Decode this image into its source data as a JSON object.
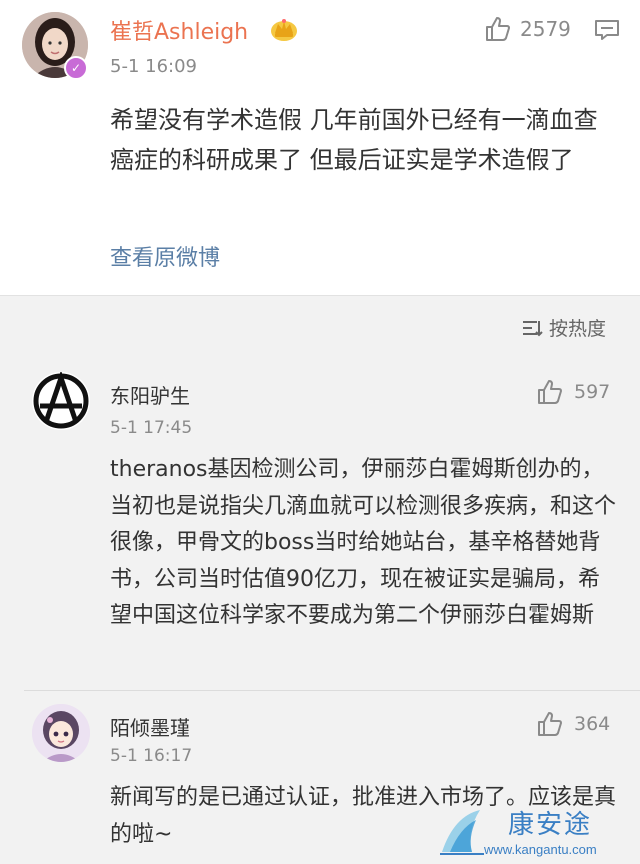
{
  "main_comment": {
    "username": "崔哲Ashleigh",
    "badge": "✓",
    "time": "5-1 16:09",
    "likes": "2579",
    "content": "希望没有学术造假 几年前国外已经有一滴血查癌症的科研成果了 但最后证实是学术造假了",
    "view_original": "查看原微博"
  },
  "sort": {
    "label": "按热度",
    "icon": "sort-icon"
  },
  "replies": [
    {
      "username": "东阳驴生",
      "time": "5-1 17:45",
      "likes": "597",
      "content": "theranos基因检测公司，伊丽莎白霍姆斯创办的，当初也是说指尖几滴血就可以检测很多疾病，和这个很像，甲骨文的boss当时给她站台，基辛格替她背书，公司当时估值90亿刀，现在被证实是骗局，希望中国这位科学家不要成为第二个伊丽莎白霍姆斯",
      "avatar": "anarchy-symbol-avatar"
    },
    {
      "username": "陌倾墨瑾",
      "time": "5-1 16:17",
      "likes": "364",
      "content": "新闻写的是已通过认证，批准进入市场了。应该是真的啦~",
      "avatar": "cartoon-girl-avatar"
    }
  ],
  "watermark": {
    "text": "康安途",
    "url": "www.kangantu.com"
  },
  "colors": {
    "username_accent": "#eb7350",
    "link": "#5b7fa6",
    "meta": "#8a8a8a",
    "background": "#f2f2f2"
  }
}
